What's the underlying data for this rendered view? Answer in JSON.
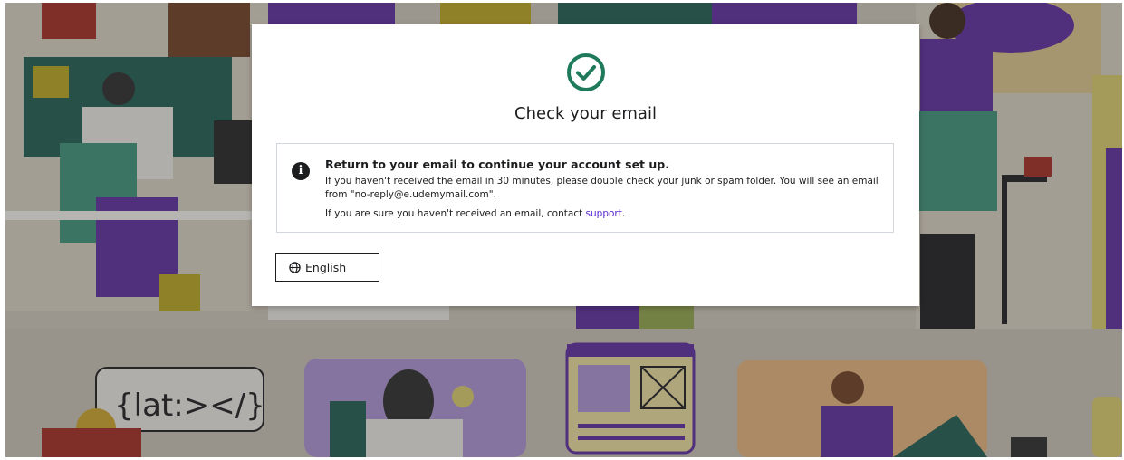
{
  "modal": {
    "title": "Check your email",
    "notice": {
      "heading": "Return to your email to continue your account set up.",
      "body": "If you haven't received the email in 30 minutes, please double check your junk or spam folder. You will see an email from \"no-reply@e.udemymail.com\".",
      "footer_prefix": "If you are sure you haven't received an email, contact ",
      "support_link": "support",
      "footer_suffix": "."
    },
    "language_button": "English"
  },
  "background": {
    "sign_text": "{lat:></}"
  },
  "colors": {
    "accent_green": "#1e7a5a",
    "link_purple": "#5624d0",
    "text": "#1c1d1f"
  }
}
